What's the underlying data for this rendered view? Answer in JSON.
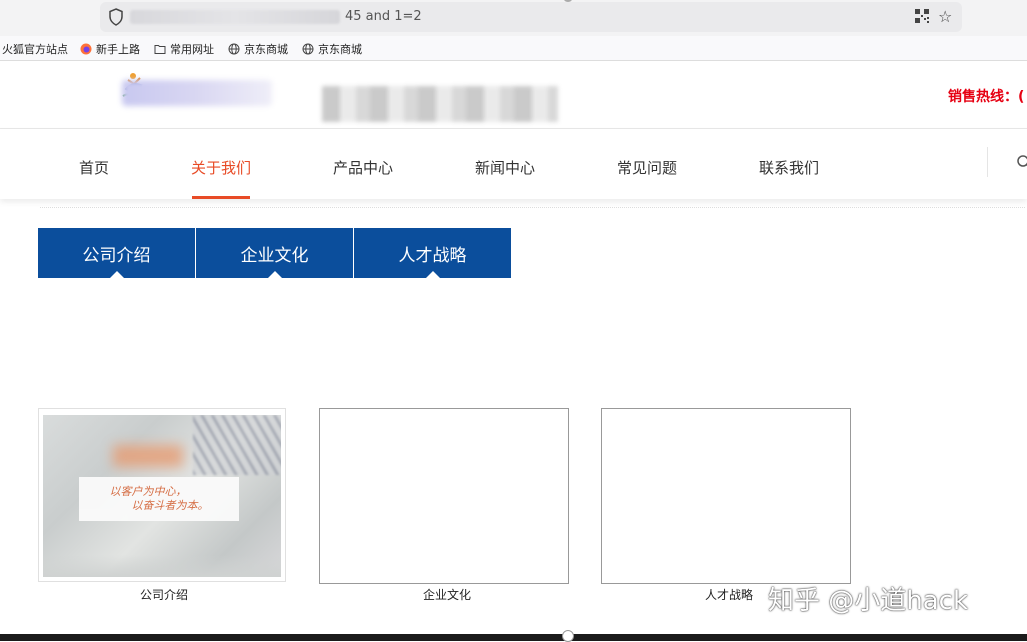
{
  "browser": {
    "url_visible_suffix": "45 and 1=2",
    "bookmarks": [
      {
        "label": "火狐官方站点",
        "icon": "firefox-icon"
      },
      {
        "label": "新手上路",
        "icon": "firefox-icon"
      },
      {
        "label": "常用网址",
        "icon": "folder-icon"
      },
      {
        "label": "京东商城",
        "icon": "globe-icon"
      },
      {
        "label": "京东商城",
        "icon": "globe-icon"
      }
    ]
  },
  "header": {
    "hotline_label": "销售热线：("
  },
  "nav": {
    "items": [
      "首页",
      "关于我们",
      "产品中心",
      "新闻中心",
      "常见问题",
      "联系我们"
    ],
    "active_index": 1,
    "accent_color": "#e84b26"
  },
  "tabs": {
    "items": [
      "公司介绍",
      "企业文化",
      "人才战略"
    ],
    "color": "#0b4e9c"
  },
  "cards": [
    {
      "caption": "公司介绍",
      "image_text_line1": "以客户为中心，",
      "image_text_line2": "以奋斗者为本。"
    },
    {
      "caption": "企业文化"
    },
    {
      "caption": "人才战略"
    }
  ],
  "watermark": "知乎 @小道hack"
}
